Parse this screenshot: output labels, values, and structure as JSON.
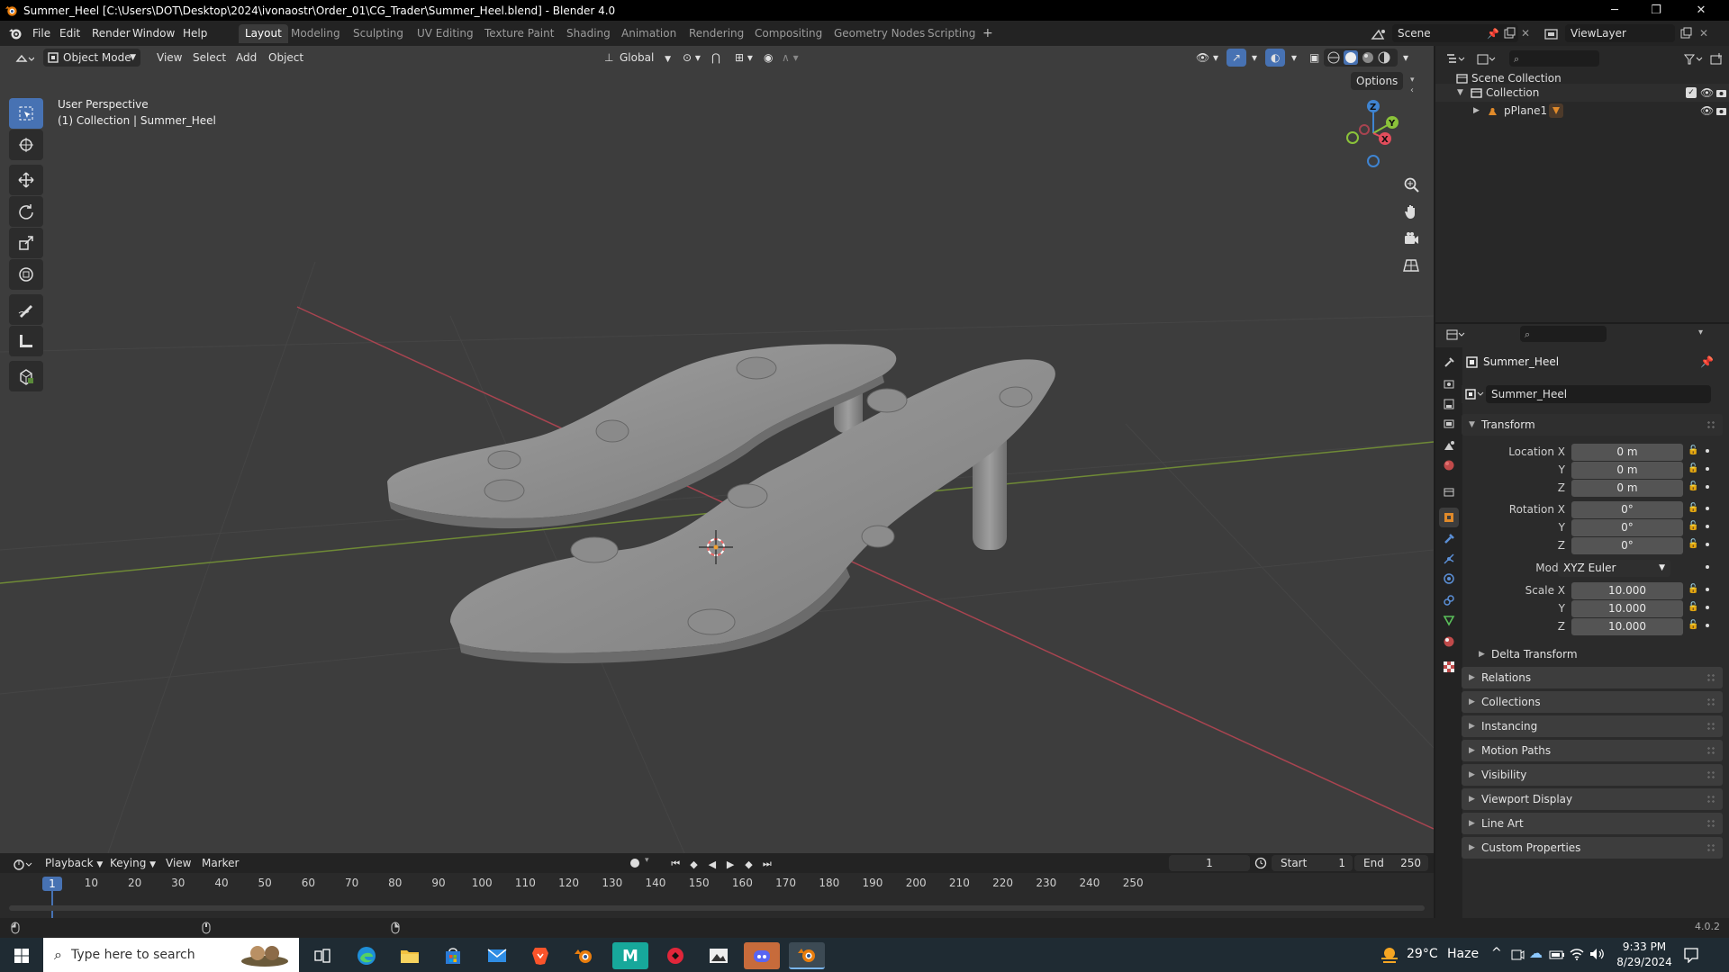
{
  "window": {
    "title": "Summer_Heel [C:\\Users\\DOT\\Desktop\\2024\\ivonaostr\\Order_01\\CG_Trader\\Summer_Heel.blend] - Blender 4.0",
    "minimize": "─",
    "maximize": "❐",
    "close": "✕"
  },
  "menu": [
    "File",
    "Edit",
    "Render",
    "Window",
    "Help"
  ],
  "workspaces": {
    "tabs": [
      "Layout",
      "Modeling",
      "Sculpting",
      "UV Editing",
      "Texture Paint",
      "Shading",
      "Animation",
      "Rendering",
      "Compositing",
      "Geometry Nodes",
      "Scripting"
    ],
    "active": "Layout",
    "add": "+"
  },
  "scene": {
    "name": "Scene"
  },
  "view_layer": {
    "name": "ViewLayer"
  },
  "viewport": {
    "mode": "Object Mode",
    "menus": [
      "View",
      "Select",
      "Add",
      "Object"
    ],
    "orientation": "Global",
    "options": "Options",
    "overlay_title": "User Perspective",
    "overlay_sub": "(1) Collection | Summer_Heel",
    "gizmo": {
      "x": "X",
      "y": "Y",
      "z": "Z"
    }
  },
  "outliner": {
    "scene_collection": "Scene Collection",
    "collection": "Collection",
    "object": "pPlane1"
  },
  "properties": {
    "object_name": "Summer_Heel",
    "datablock": "Summer_Heel",
    "transform": {
      "title": "Transform",
      "location_label": "Location X",
      "y_label": "Y",
      "z_label": "Z",
      "location": [
        "0 m",
        "0 m",
        "0 m"
      ],
      "rotation_label": "Rotation X",
      "rotation": [
        "0°",
        "0°",
        "0°"
      ],
      "mode_label": "Mode",
      "mode": "XYZ Euler",
      "scale_label": "Scale X",
      "scale": [
        "10.000",
        "10.000",
        "10.000"
      ]
    },
    "delta_transform": "Delta Transform",
    "panels": [
      "Relations",
      "Collections",
      "Instancing",
      "Motion Paths",
      "Visibility",
      "Viewport Display",
      "Line Art",
      "Custom Properties"
    ]
  },
  "timeline": {
    "menus": [
      "Playback",
      "Keying",
      "View",
      "Marker"
    ],
    "current_frame": "1",
    "start_label": "Start",
    "start": "1",
    "end_label": "End",
    "end": "250",
    "ruler": [
      "10",
      "20",
      "30",
      "40",
      "50",
      "60",
      "70",
      "80",
      "90",
      "100",
      "110",
      "120",
      "130",
      "140",
      "150",
      "160",
      "170",
      "180",
      "190",
      "200",
      "210",
      "220",
      "230",
      "240",
      "250"
    ],
    "playhead": "1"
  },
  "status": {
    "version": "4.0.2"
  },
  "taskbar": {
    "search_placeholder": "Type here to search",
    "weather_temp": "29°C",
    "weather_desc": "Haze",
    "time": "9:33 PM",
    "date": "8/29/2024"
  },
  "colors": {
    "accent": "#4772b3",
    "object_orange": "#e08a2a",
    "x_axis": "#e24d5c",
    "y_axis": "#8bc33a",
    "z_axis": "#3f84d1"
  }
}
